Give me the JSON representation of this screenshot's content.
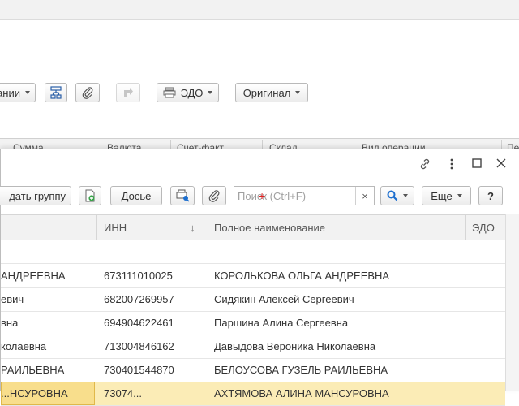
{
  "background_toolbar": {
    "operations_label": "ании",
    "edo_label": "ЭДО",
    "original_label": "Оригинал",
    "columns": [
      "Сумма",
      "Валюта",
      "Счет-факт...",
      "Склад",
      "Вид операции",
      "Пе"
    ]
  },
  "dialog": {
    "toolbar": {
      "add_group_label": "дать группу",
      "dossier_label": "Досье",
      "search_placeholder": "Поиск (Ctrl+F)",
      "search_clear": "×",
      "more_label": "Еще",
      "help_label": "?"
    },
    "table": {
      "headers": {
        "inn": "ИНН",
        "sort_indicator": "↓",
        "full_name": "Полное наименование",
        "edo": "ЭДО"
      },
      "rows": [
        {
          "name": "",
          "inn": "",
          "full_name": "",
          "edo": ""
        },
        {
          "name": "АНДРЕЕВНА",
          "inn": "673111010025",
          "full_name": "КОРОЛЬКОВА ОЛЬГА АНДРЕЕВНА",
          "edo": ""
        },
        {
          "name": "евич",
          "inn": "682007269957",
          "full_name": "Сидякин Алексей Сергеевич",
          "edo": ""
        },
        {
          "name": "вна",
          "inn": "694904622461",
          "full_name": "Паршина Алина Сергеевна",
          "edo": ""
        },
        {
          "name": "колаевна",
          "inn": "713004846162",
          "full_name": "Давыдова Вероника Николаевна",
          "edo": ""
        },
        {
          "name": "РАИЛЬЕВНА",
          "inn": "730401544870",
          "full_name": "БЕЛОУСОВА ГУЗЕЛЬ РАИЛЬЕВНА",
          "edo": ""
        },
        {
          "name": "...НСУРОВНА",
          "inn": "73074...",
          "full_name": "АХТЯМОВА АЛИНА МАНСУРОВНА",
          "edo": ""
        }
      ]
    }
  },
  "colors": {
    "selected_row": "#fbecb6",
    "search_accent": "#1d6fcf",
    "add_icon": "#3aa34a"
  }
}
